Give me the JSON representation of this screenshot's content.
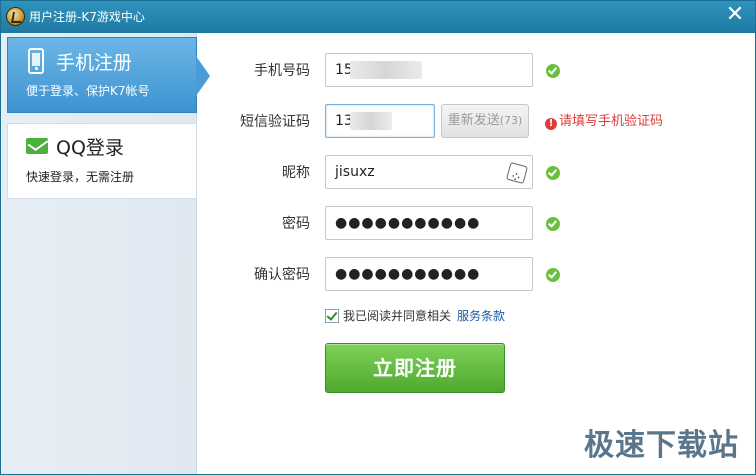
{
  "window": {
    "title": "用户注册-K7游戏中心"
  },
  "sidebar": {
    "tabs": [
      {
        "title": "手机注册",
        "subtitle": "便于登录、保护K7帐号",
        "icon": "phone-icon"
      },
      {
        "title": "QQ登录",
        "subtitle": "快速登录，无需注册",
        "icon": "mail-icon"
      }
    ]
  },
  "form": {
    "phone": {
      "label": "手机号码",
      "value": "15"
    },
    "sms": {
      "label": "短信验证码",
      "value": "13",
      "resend_label": "重新发送",
      "resend_count": "(73)",
      "error": "请填写手机验证码"
    },
    "nickname": {
      "label": "昵称",
      "value": "jisuxz"
    },
    "password": {
      "label": "密码",
      "value": "●●●●●●●●●●●"
    },
    "confirm": {
      "label": "确认密码",
      "value": "●●●●●●●●●●●"
    },
    "agree_text": "我已阅读并同意相关",
    "terms_link": "服务条款",
    "submit_label": "立即注册"
  },
  "watermark": "极速下载站",
  "colors": {
    "title_bar": "#1f7aa3",
    "active_tab": "#3d93d0",
    "submit": "#4ea92e",
    "error": "#e03a3a",
    "ok": "#6bbf3f"
  }
}
